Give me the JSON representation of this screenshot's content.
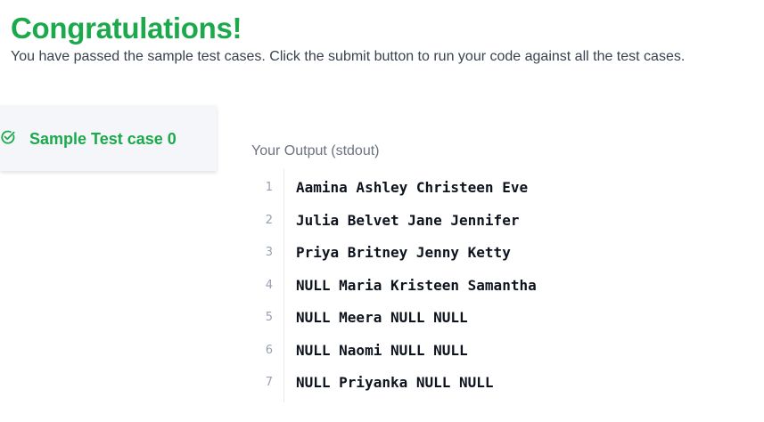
{
  "header": {
    "title": "Congratulations!",
    "message": "You have passed the sample test cases. Click the submit button to run your code against all the test cases."
  },
  "tabs": [
    {
      "label": "Sample Test case 0",
      "status": "passed",
      "icon": "check-circle-icon"
    }
  ],
  "output": {
    "title": "Your Output (stdout)",
    "lines": [
      {
        "number": "1",
        "text": "Aamina Ashley Christeen Eve"
      },
      {
        "number": "2",
        "text": "Julia Belvet Jane Jennifer"
      },
      {
        "number": "3",
        "text": "Priya Britney Jenny Ketty"
      },
      {
        "number": "4",
        "text": "NULL Maria Kristeen Samantha"
      },
      {
        "number": "5",
        "text": "NULL Meera NULL NULL"
      },
      {
        "number": "6",
        "text": "NULL Naomi NULL NULL"
      },
      {
        "number": "7",
        "text": "NULL Priyanka NULL NULL"
      }
    ]
  },
  "colors": {
    "success": "#1ba94c",
    "text": "#39424e",
    "code": "#0e141e",
    "muted": "#979faf"
  }
}
